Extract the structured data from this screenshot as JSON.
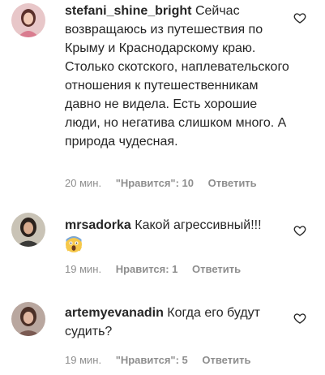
{
  "comments": [
    {
      "username": "stefani_shine_bright",
      "text": "Сейчас возвращаюсь из путешествия по Крыму и Краснодарскому краю. Столько скотского, наплевательского отношения к путешественникам давно не видела. Есть хорошие люди, но негатива слишком много. А природа чудесная.",
      "time": "20 мин.",
      "likes": "\"Нравится\": 10",
      "reply": "Ответить",
      "icon": "heart-outline-icon"
    },
    {
      "username": "mrsadorka",
      "text": "Какой агрессивный!!!",
      "emoji": "screaming-face-emoji",
      "time": "19 мин.",
      "likes": "Нравится: 1",
      "reply": "Ответить",
      "icon": "heart-outline-icon"
    },
    {
      "username": "artemyevanadin",
      "text": "Когда его будут судить?",
      "time": "19 мин.",
      "likes": "\"Нравится\": 5",
      "reply": "Ответить",
      "icon": "heart-outline-icon"
    }
  ]
}
